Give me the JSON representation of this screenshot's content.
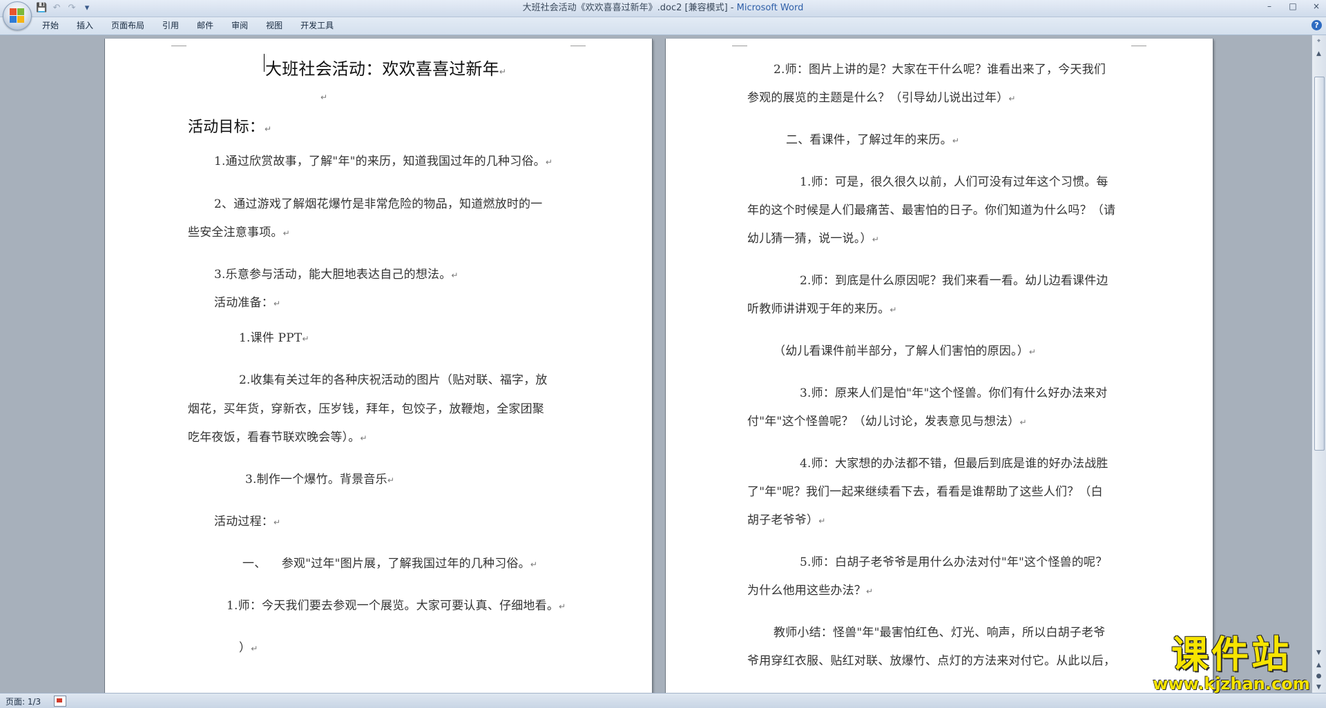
{
  "window": {
    "title": "大班社会活动《欢欢喜喜过新年》.doc2 [兼容模式] - ",
    "app_name": "Microsoft Word",
    "controls": {
      "minimize": "–",
      "maximize": "□",
      "close": "×"
    }
  },
  "quick_access": {
    "save_icon": "💾",
    "undo_icon": "↶",
    "redo_icon": "↷",
    "customize_icon": "▾"
  },
  "ribbon": {
    "tabs": [
      "开始",
      "插入",
      "页面布局",
      "引用",
      "邮件",
      "审阅",
      "视图",
      "开发工具"
    ],
    "help": "?"
  },
  "pilcrow": "↵",
  "left_page": {
    "title": "大班社会活动：欢欢喜喜过新年",
    "lines": [
      "",
      "活动目标：",
      "1.通过欣赏故事，了解\"年\"的来历，知道我国过年的几种习俗。",
      "2、通过游戏了解烟花爆竹是非常危险的物品，知道燃放时的一",
      "些安全注意事项。",
      "3.乐意参与活动，能大胆地表达自己的想法。",
      "活动准备：",
      "1.课件 PPT",
      "2.收集有关过年的各种庆祝活动的图片（贴对联、福字，放",
      "烟花，买年货，穿新衣，压岁钱，拜年，包饺子，放鞭炮，全家团聚",
      "吃年夜饭，看春节联欢晚会等）。",
      "3.制作一个爆竹。背景音乐",
      "活动过程：",
      "一、    参观\"过年\"图片展，了解我国过年的几种习俗。",
      "1.师：今天我们要去参观一个展览。大家可要认真、仔细地看。",
      "）"
    ]
  },
  "right_page": {
    "lines": [
      "2.师：图片上讲的是？大家在干什么呢？谁看出来了，今天我们",
      "参观的展览的主题是什么？（引导幼儿说出过年）",
      "二、看课件，了解过年的来历。",
      "1.师：可是，很久很久以前，人们可没有过年这个习惯。每",
      "年的这个时候是人们最痛苦、最害怕的日子。你们知道为什么吗？（请",
      "幼儿猜一猜，说一说。）",
      "2.师：到底是什么原因呢？我们来看一看。幼儿边看课件边",
      "听教师讲讲观于年的来历。",
      "（幼儿看课件前半部分，了解人们害怕的原因。）",
      "3.师：原来人们是怕\"年\"这个怪兽。你们有什么好办法来对",
      "付\"年\"这个怪兽呢？（幼儿讨论，发表意见与想法）",
      "4.师：大家想的办法都不错，但最后到底是谁的好办法战胜",
      "了\"年\"呢？我们一起来继续看下去，看看是谁帮助了这些人们？（白",
      "胡子老爷爷）",
      "5.师：白胡子老爷爷是用什么办法对付\"年\"这个怪兽的呢？",
      "为什么他用这些办法？",
      "教师小结：怪兽\"年\"最害怕红色、灯光、响声，所以白胡子老爷",
      "爷用穿红衣服、贴红对联、放爆竹、点灯的方法来对付它。从此以后，"
    ]
  },
  "status_bar": {
    "page_info": "页面: 1/3"
  },
  "watermark": {
    "brand": "课件站",
    "url": "www.kjzhan.com"
  }
}
